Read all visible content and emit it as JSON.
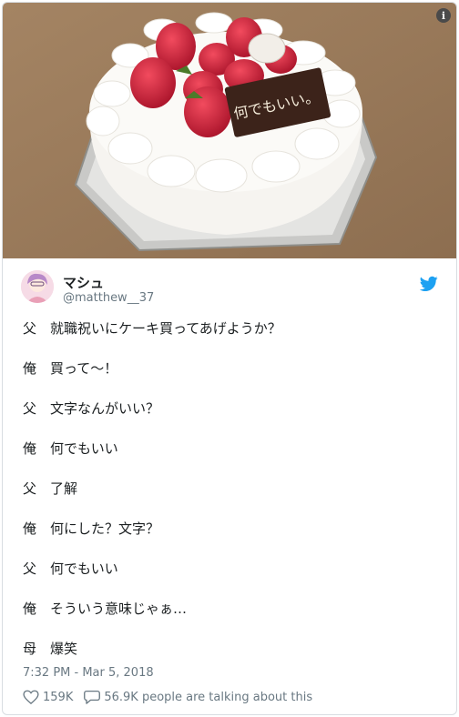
{
  "tweet": {
    "author_name": "マシュ",
    "author_handle": "@matthew__37",
    "cake_plaque_text": "何でもいい。",
    "lines": [
      {
        "speaker": "父",
        "text": "就職祝いにケーキ買ってあげようか？"
      },
      {
        "speaker": "俺",
        "text": "買って〜！"
      },
      {
        "speaker": "父",
        "text": "文字なんがいい？"
      },
      {
        "speaker": "俺",
        "text": "何でもいい"
      },
      {
        "speaker": "父",
        "text": "了解"
      },
      {
        "speaker": "俺",
        "text": "何にした？文字？"
      },
      {
        "speaker": "父",
        "text": "何でもいい"
      },
      {
        "speaker": "俺",
        "text": "そういう意味じゃぁ…"
      },
      {
        "speaker": "母",
        "text": "爆笑"
      }
    ],
    "timestamp": "7:32 PM - Mar 5, 2018",
    "likes": "159K",
    "talking": "56.9K people are talking about this"
  },
  "icons": {
    "info": "info-icon",
    "bird": "twitter-bird-icon",
    "heart": "heart-icon",
    "reply": "speech-bubble-icon"
  },
  "colors": {
    "brand": "#1da1f2",
    "text": "#1c2022",
    "muted": "#697882"
  }
}
